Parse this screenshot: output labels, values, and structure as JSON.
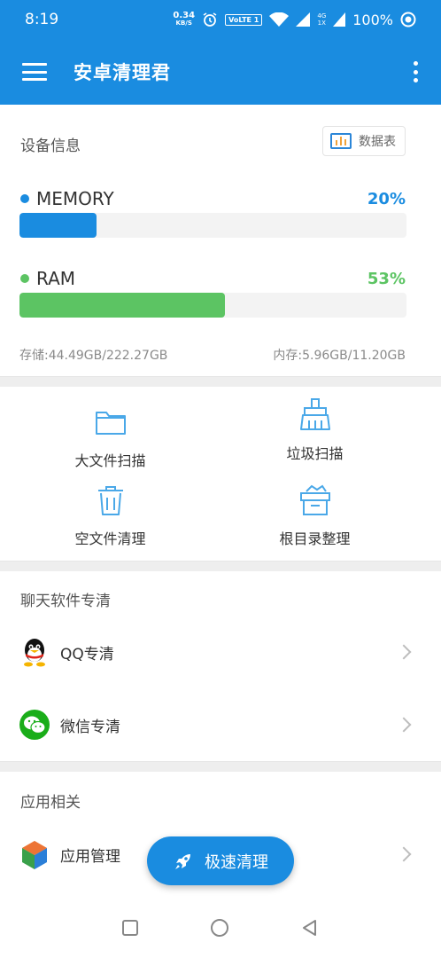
{
  "status_bar": {
    "time": "8:19",
    "speed_value": "0.34",
    "speed_unit": "KB/S",
    "volte": "VoLTE 1",
    "network_top": "4G",
    "network_bottom": "1X",
    "battery": "100%"
  },
  "app_bar": {
    "title": "安卓清理君"
  },
  "device_info": {
    "title": "设备信息",
    "datatable_label": "数据表",
    "memory": {
      "label": "MEMORY",
      "percent_text": "20%",
      "percent": 20,
      "color": "#1a8ce0"
    },
    "ram": {
      "label": "RAM",
      "percent_text": "53%",
      "percent": 53,
      "color": "#5cc463"
    },
    "storage_text": "存储:44.49GB/222.27GB",
    "memory_text": "内存:5.96GB/11.20GB"
  },
  "tools": [
    {
      "label": "大文件扫描",
      "icon": "folder-icon"
    },
    {
      "label": "垃圾扫描",
      "icon": "broom-icon"
    },
    {
      "label": "空文件清理",
      "icon": "trash-icon"
    },
    {
      "label": "根目录整理",
      "icon": "box-icon"
    }
  ],
  "chat_section": {
    "title": "聊天软件专清",
    "items": [
      {
        "label": "QQ专清",
        "icon": "qq-icon"
      },
      {
        "label": "微信专清",
        "icon": "wechat-icon"
      }
    ]
  },
  "app_section": {
    "title": "应用相关",
    "items": [
      {
        "label": "应用管理",
        "icon": "cube-icon"
      }
    ]
  },
  "fab": {
    "label": "极速清理",
    "icon": "rocket-icon"
  },
  "colors": {
    "primary": "#1a8ce0",
    "memory_bar": "#1a8ce0",
    "ram_bar": "#5cc463",
    "icon_stroke": "#4aa8e8"
  }
}
